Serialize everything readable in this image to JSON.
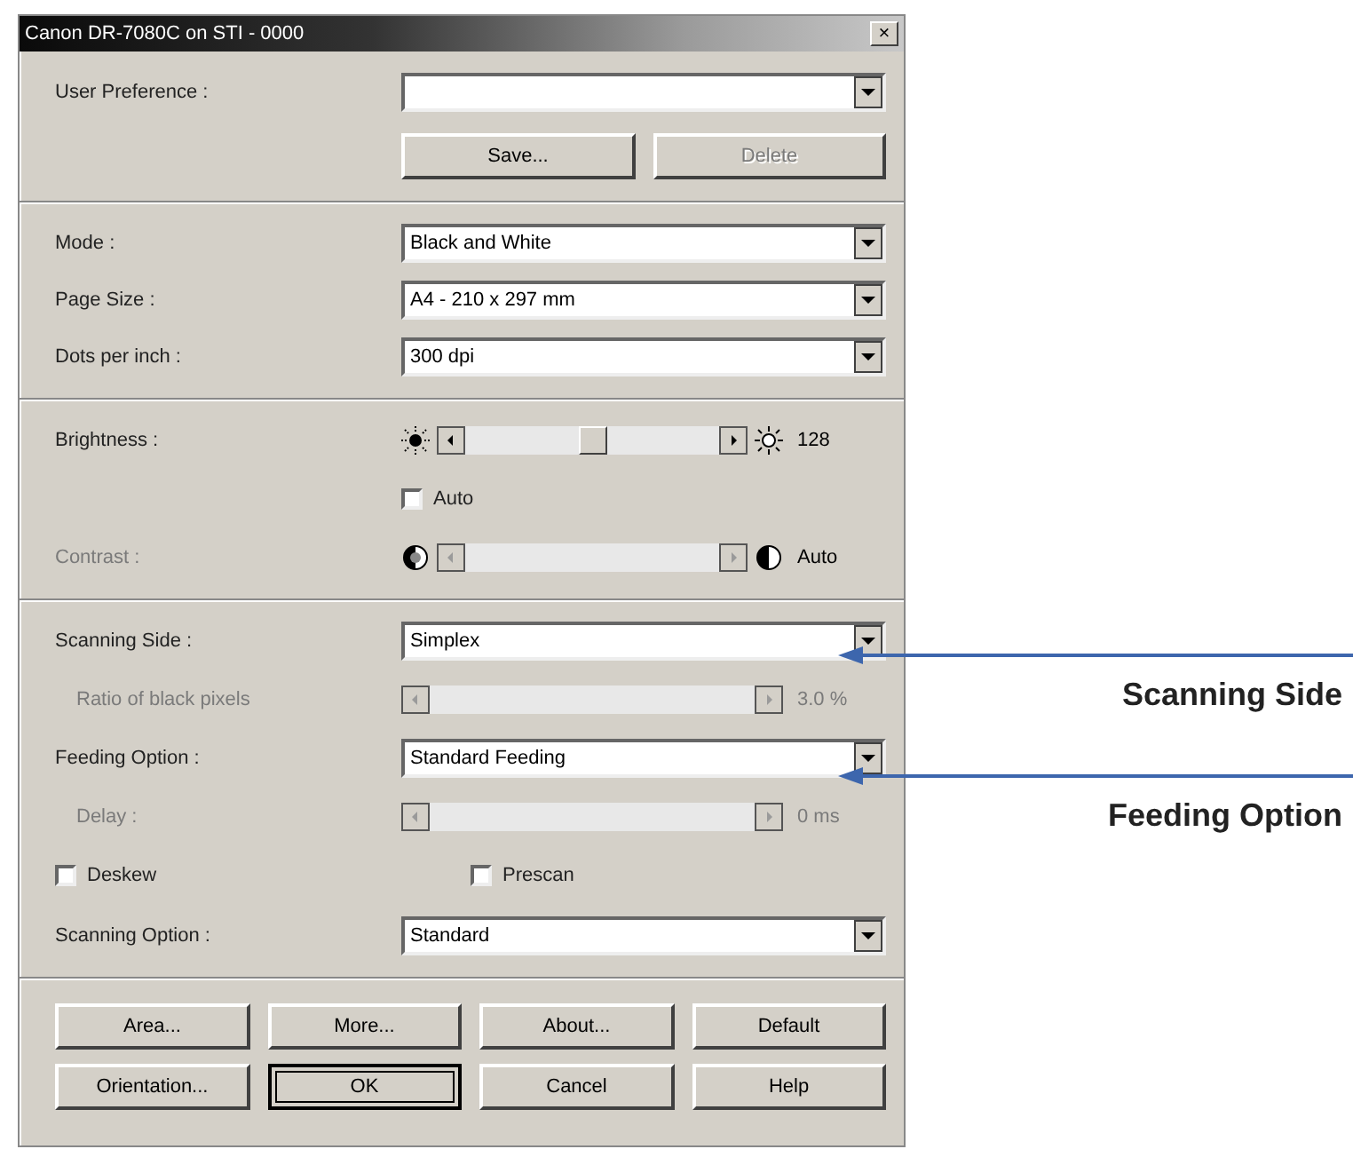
{
  "window": {
    "title": "Canon DR-7080C on STI - 0000",
    "close": "×"
  },
  "sections": [
    {
      "rows": [
        {
          "kind": "combo",
          "label": "User Preference :",
          "value": ""
        },
        {
          "kind": "buttons",
          "buttons": [
            {
              "label": "Save...",
              "disabled": false
            },
            {
              "label": "Delete",
              "disabled": true
            }
          ]
        }
      ]
    },
    {
      "rows": [
        {
          "kind": "combo",
          "label": "Mode :",
          "value": "Black and White"
        },
        {
          "kind": "combo",
          "label": "Page Size :",
          "value": "A4 - 210 x 297 mm"
        },
        {
          "kind": "combo",
          "label": "Dots per inch :",
          "value": "300 dpi"
        }
      ]
    },
    {
      "rows": [
        {
          "kind": "brightness_slider",
          "label": "Brightness :",
          "disabled": false,
          "level": 0.5,
          "reading": "128"
        },
        {
          "kind": "checkbox",
          "label": "Auto",
          "checked": false
        },
        {
          "kind": "contrast_slider",
          "label": "Contrast :",
          "disabled": true,
          "reading": "Auto"
        }
      ]
    },
    {
      "rows": [
        {
          "kind": "combo",
          "label": "Scanning Side :",
          "value": "Simplex"
        },
        {
          "kind": "slider",
          "label": "Ratio of black pixels",
          "disabled": true,
          "reading": "3.0 %"
        },
        {
          "kind": "combo",
          "label": "Feeding Option :",
          "value": "Standard Feeding"
        },
        {
          "kind": "slider",
          "label": "Delay :",
          "disabled": true,
          "reading": "0 ms"
        },
        {
          "kind": "checkpair",
          "items": [
            {
              "label": "Deskew",
              "checked": false
            },
            {
              "label": "Prescan",
              "checked": false
            }
          ]
        },
        {
          "kind": "combo",
          "label": "Scanning Option :",
          "value": "Standard"
        }
      ]
    }
  ],
  "buttons": [
    {
      "label": "Area...",
      "default": false
    },
    {
      "label": "More...",
      "default": false
    },
    {
      "label": "About...",
      "default": false
    },
    {
      "label": "Default",
      "default": false
    },
    {
      "label": "Orientation...",
      "default": false
    },
    {
      "label": "OK",
      "default": true
    },
    {
      "label": "Cancel",
      "default": false
    },
    {
      "label": "Help",
      "default": false
    }
  ],
  "callouts": [
    {
      "text": "Scanning Side"
    },
    {
      "text": "Feeding Option"
    }
  ]
}
